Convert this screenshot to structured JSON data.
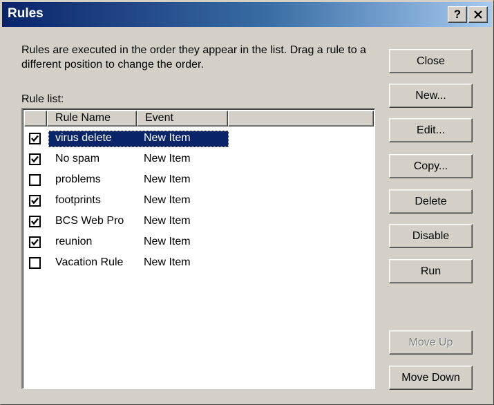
{
  "window": {
    "title": "Rules",
    "help_label": "?",
    "close_label": "✕"
  },
  "description": "Rules are executed in the order they appear in the list.  Drag a rule to a different position to change the order.",
  "rule_list_label": "Rule list:",
  "columns": {
    "rule_name": "Rule Name",
    "event": "Event"
  },
  "rules": [
    {
      "name": "virus delete",
      "event": "New Item",
      "checked": true,
      "selected": true
    },
    {
      "name": "No spam",
      "event": "New Item",
      "checked": true,
      "selected": false
    },
    {
      "name": "problems",
      "event": "New Item",
      "checked": false,
      "selected": false
    },
    {
      "name": "footprints",
      "event": "New Item",
      "checked": true,
      "selected": false
    },
    {
      "name": "BCS Web Pro",
      "event": "New Item",
      "checked": true,
      "selected": false
    },
    {
      "name": "reunion",
      "event": "New Item",
      "checked": true,
      "selected": false
    },
    {
      "name": "Vacation Rule",
      "event": "New Item",
      "checked": false,
      "selected": false
    }
  ],
  "buttons": {
    "close": "Close",
    "new": "New...",
    "edit": "Edit...",
    "copy": "Copy...",
    "delete": "Delete",
    "disable": "Disable",
    "run": "Run",
    "move_up": "Move Up",
    "move_down": "Move Down"
  },
  "colors": {
    "selection": "#0a246a",
    "title_gradient_start": "#0a246a",
    "title_gradient_end": "#a6caf0",
    "dialog_face": "#d4d0c8"
  }
}
